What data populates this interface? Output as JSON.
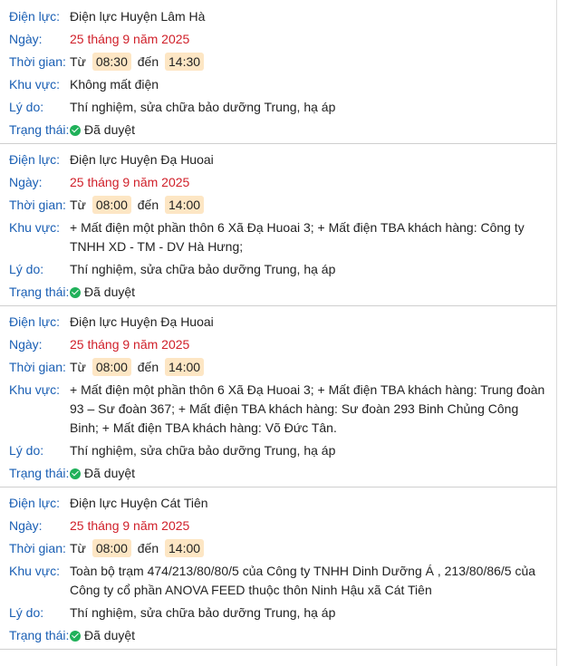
{
  "labels": {
    "unit": "Điện lực:",
    "date": "Ngày:",
    "time": "Thời gian:",
    "area": "Khu vực:",
    "reason": "Lý do:",
    "status": "Trạng thái:",
    "from": "Từ",
    "to": "đến"
  },
  "colors": {
    "label": "#1a5fb4",
    "date": "#d0202a",
    "time_highlight": "#fde6c4",
    "status_check": "#20b15a"
  },
  "outages": [
    {
      "unit": "Điện lực Huyện Lâm Hà",
      "date": "25 tháng 9 năm 2025",
      "start": "08:30",
      "end": "14:30",
      "area": "Không mất điện",
      "reason": "Thí nghiệm, sửa chữa bảo dưỡng Trung, hạ áp",
      "status": "Đã duyệt",
      "status_icon": "check-circle-icon"
    },
    {
      "unit": "Điện lực Huyện Đạ Huoai",
      "date": "25 tháng 9 năm 2025",
      "start": "08:00",
      "end": "14:00",
      "area": "+ Mất điện một phần thôn 6 Xã Đạ Huoai 3; + Mất điện TBA khách hàng: Công ty TNHH XD - TM - DV Hà Hưng;",
      "reason": "Thí nghiệm, sửa chữa bảo dưỡng Trung, hạ áp",
      "status": "Đã duyệt",
      "status_icon": "check-circle-icon"
    },
    {
      "unit": "Điện lực Huyện Đạ Huoai",
      "date": "25 tháng 9 năm 2025",
      "start": "08:00",
      "end": "14:00",
      "area": "+ Mất điện một phần thôn 6 Xã Đạ Huoai 3; + Mất điện TBA khách hàng: Trung đoàn 93 – Sư đoàn 367; + Mất điện TBA khách hàng: Sư đoàn 293 Binh Chủng Công Binh; + Mất điện TBA khách hàng: Võ Đức Tân.",
      "reason": "Thí nghiệm, sửa chữa bảo dưỡng Trung, hạ áp",
      "status": "Đã duyệt",
      "status_icon": "check-circle-icon"
    },
    {
      "unit": "Điện lực Huyện Cát Tiên",
      "date": "25 tháng 9 năm 2025",
      "start": "08:00",
      "end": "14:00",
      "area": "Toàn bộ trạm 474/213/80/80/5 của Công ty TNHH Dinh Dưỡng Á , 213/80/86/5 của Công ty cổ phần ANOVA FEED thuộc thôn Ninh Hậu xã Cát Tiên",
      "reason": "Thí nghiệm, sửa chữa bảo dưỡng Trung, hạ áp",
      "status": "Đã duyệt",
      "status_icon": "check-circle-icon"
    }
  ]
}
